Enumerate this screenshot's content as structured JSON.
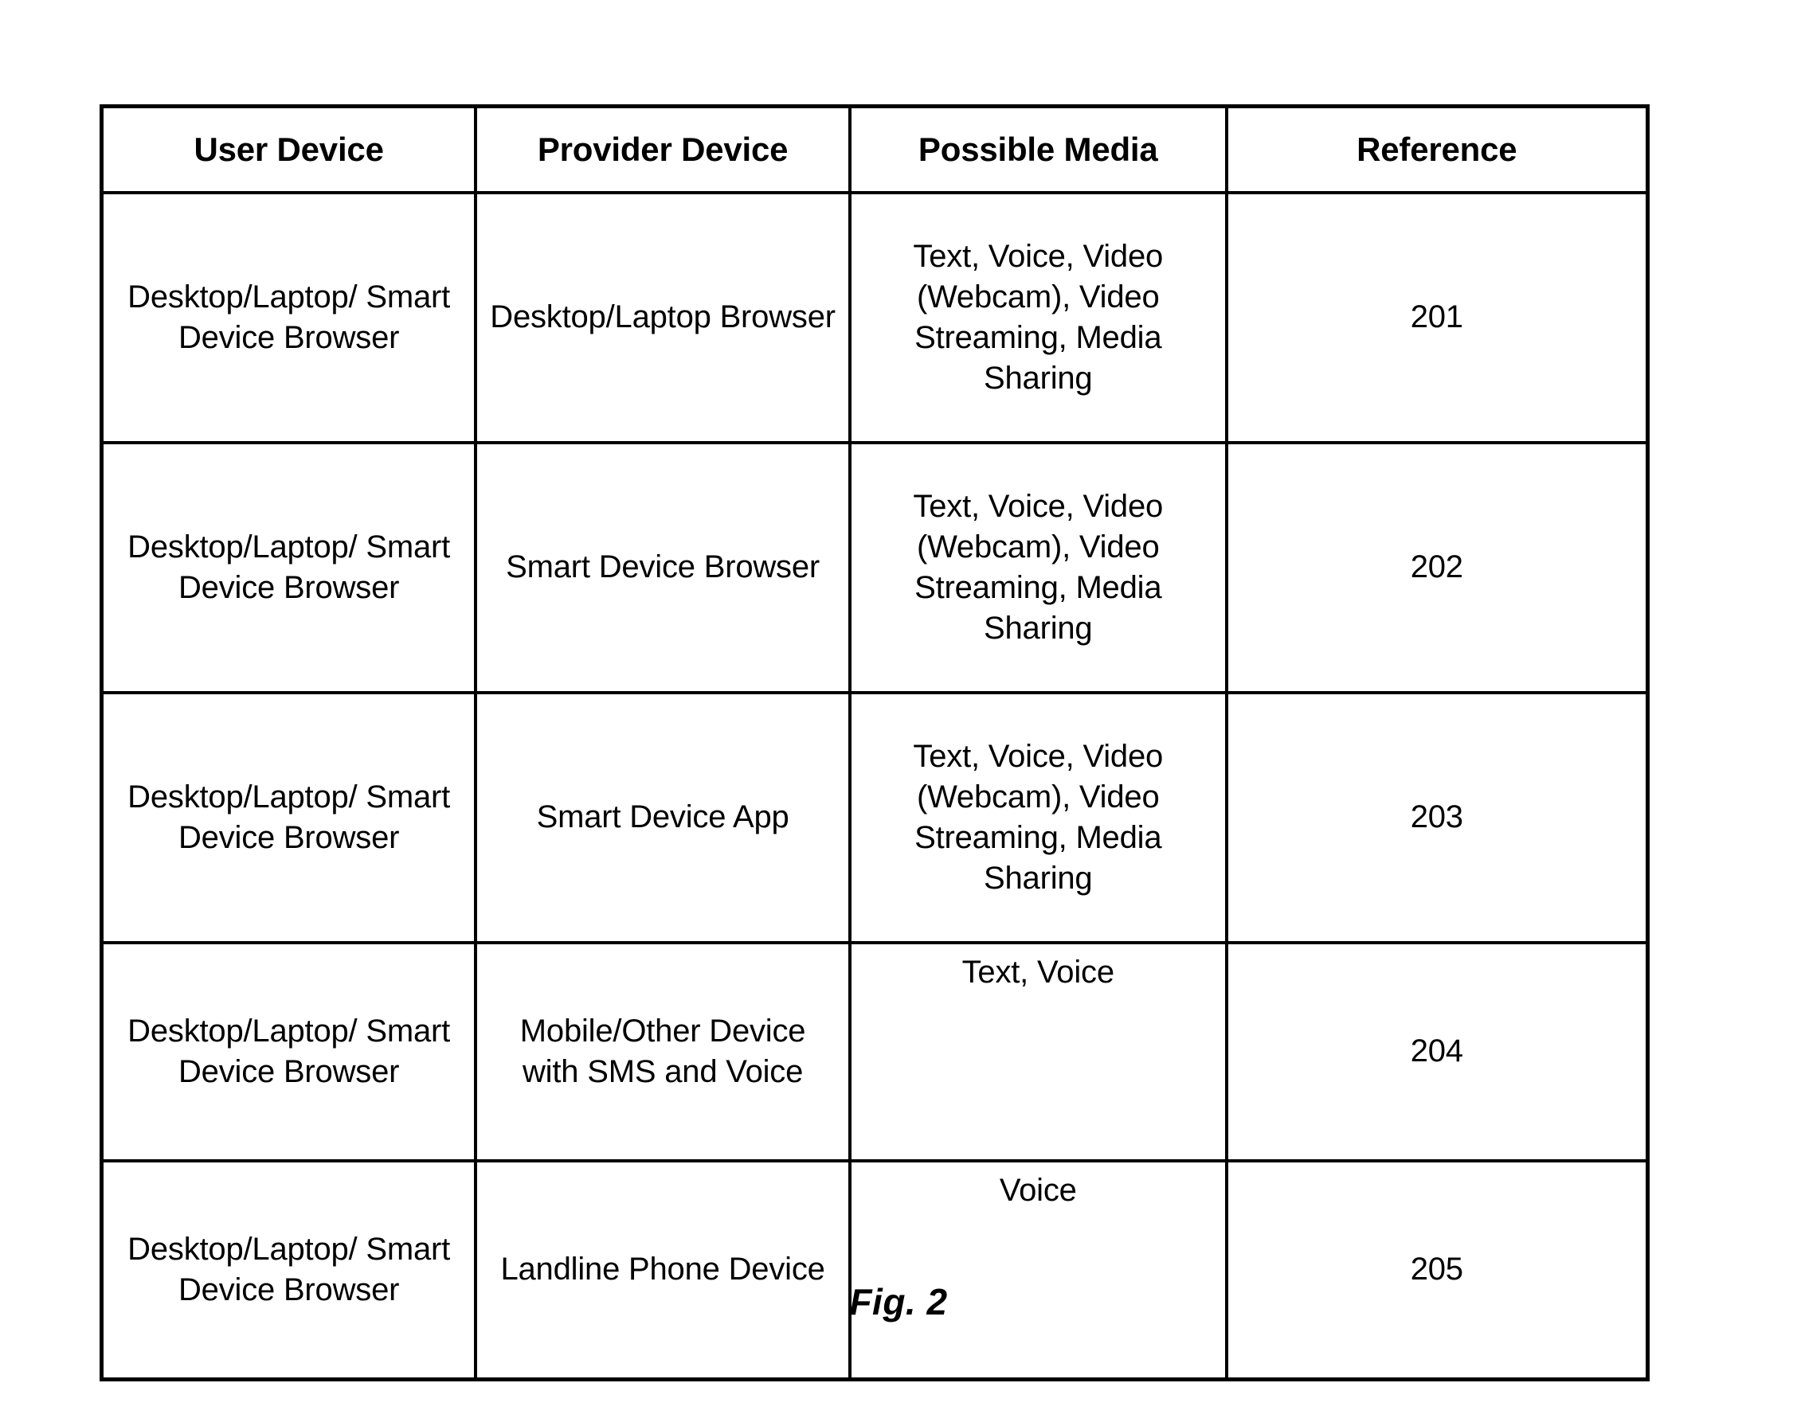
{
  "figure": {
    "caption": "Fig. 2"
  },
  "table": {
    "headers": [
      "User Device",
      "Provider Device",
      "Possible Media",
      "Reference"
    ],
    "rows": [
      {
        "user_device": "Desktop/Laptop/ Smart Device Browser",
        "provider_device": "Desktop/Laptop Browser",
        "possible_media": "Text, Voice, Video (Webcam), Video Streaming, Media Sharing",
        "reference": "201"
      },
      {
        "user_device": "Desktop/Laptop/ Smart Device Browser",
        "provider_device": "Smart Device Browser",
        "possible_media": "Text, Voice, Video (Webcam), Video Streaming, Media Sharing",
        "reference": "202"
      },
      {
        "user_device": "Desktop/Laptop/ Smart Device Browser",
        "provider_device": "Smart Device App",
        "possible_media": "Text, Voice, Video (Webcam), Video Streaming, Media Sharing",
        "reference": "203"
      },
      {
        "user_device": "Desktop/Laptop/ Smart Device Browser",
        "provider_device": "Mobile/Other Device with SMS and Voice",
        "possible_media": "Text, Voice",
        "reference": "204"
      },
      {
        "user_device": "Desktop/Laptop/ Smart Device Browser",
        "provider_device": "Landline Phone Device",
        "possible_media": "Voice",
        "reference": "205"
      }
    ]
  },
  "colors": {
    "border": "#000000",
    "text": "#000000",
    "background": "#ffffff"
  }
}
